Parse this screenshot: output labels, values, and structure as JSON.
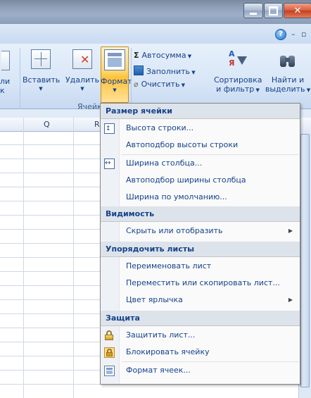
{
  "titlebar": {
    "minimize_icon": "minimize-icon",
    "maximize_icon": "maximize-icon",
    "close_icon": "close-icon"
  },
  "ribbon_top": {
    "help_icon": "help-icon"
  },
  "ribbon": {
    "partial_left_label_1": "ли",
    "partial_left_label_2": "к",
    "insert_label": "Вставить",
    "delete_label": "Удалить",
    "format_label": "Формат",
    "cells_group": "Ячейки",
    "autosum_label": "Автосумма",
    "fill_label": "Заполнить",
    "clear_label": "Очистить",
    "sort_label_1": "Сортировка",
    "sort_label_2": "и фильтр",
    "find_label_1": "Найти и",
    "find_label_2": "выделить"
  },
  "columns": [
    "Q",
    "R"
  ],
  "menu": {
    "sections": [
      {
        "header": "Размер ячейки",
        "items": [
          {
            "label": "Высота строки...",
            "icon": "row-height-icon"
          },
          {
            "label": "Автоподбор высоты строки",
            "icon": ""
          },
          {
            "label": "Ширина столбца...",
            "icon": "column-width-icon"
          },
          {
            "label": "Автоподбор ширины столбца",
            "icon": ""
          },
          {
            "label": "Ширина по умолчанию...",
            "icon": ""
          }
        ]
      },
      {
        "header": "Видимость",
        "items": [
          {
            "label": "Скрыть или отобразить",
            "icon": "",
            "submenu": true
          }
        ]
      },
      {
        "header": "Упорядочить листы",
        "items": [
          {
            "label": "Переименовать лист",
            "icon": ""
          },
          {
            "label": "Переместить или скопировать лист...",
            "icon": ""
          },
          {
            "label": "Цвет ярлычка",
            "icon": "",
            "submenu": true
          }
        ]
      },
      {
        "header": "Защита",
        "items": [
          {
            "label": "Защитить лист...",
            "icon": "protect-sheet-icon"
          },
          {
            "label": "Блокировать ячейку",
            "icon": "lock-cell-icon"
          },
          {
            "label": "Формат ячеек...",
            "icon": "format-cells-icon"
          }
        ]
      }
    ]
  }
}
